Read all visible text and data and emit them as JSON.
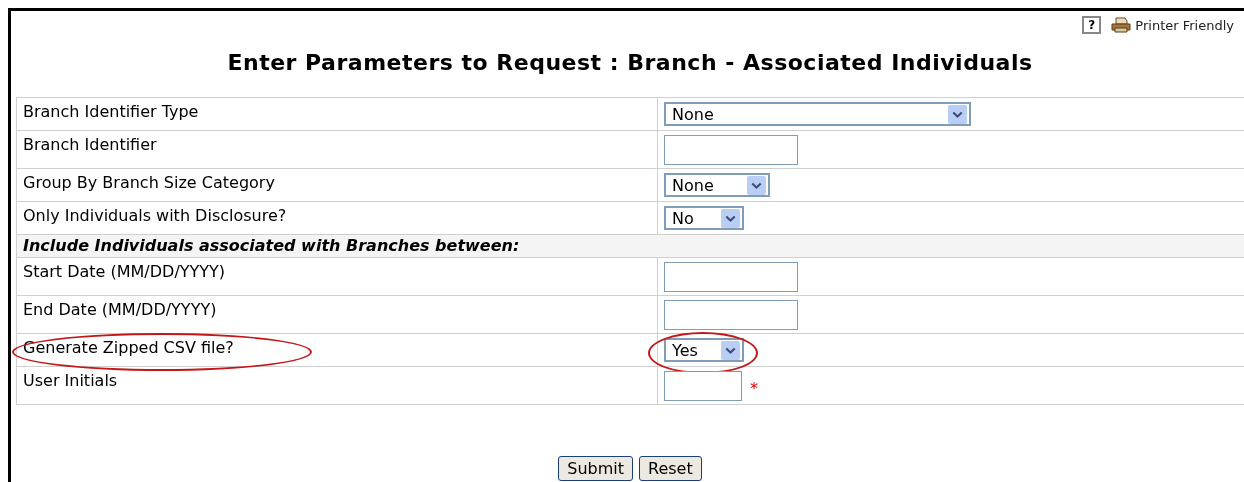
{
  "toolbar": {
    "help": "?",
    "printer_link": "Printer Friendly"
  },
  "title": "Enter Parameters to Request : Branch - Associated Individuals",
  "rows": [
    {
      "kind": "select",
      "label": "Branch Identifier Type",
      "value": "None",
      "highlighted": false
    },
    {
      "kind": "input",
      "label": "Branch Identifier",
      "highlighted": false
    },
    {
      "kind": "select",
      "label": "Group By Branch Size Category",
      "value": "None",
      "highlighted": false
    },
    {
      "kind": "select",
      "label": "Only Individuals with Disclosure?",
      "value": "No",
      "highlighted": false
    },
    {
      "kind": "section",
      "label": "Include Individuals associated with Branches between:"
    },
    {
      "kind": "input",
      "label": "Start Date (MM/DD/YYYY)",
      "highlighted": false
    },
    {
      "kind": "input",
      "label": "End Date (MM/DD/YYYY)",
      "highlighted": false
    },
    {
      "kind": "select",
      "label": "Generate Zipped CSV file?",
      "value": "Yes",
      "highlighted": true
    },
    {
      "kind": "input",
      "label": "User Initials",
      "required": "*",
      "highlighted": false
    }
  ],
  "buttons": [
    "Submit",
    "Reset"
  ]
}
